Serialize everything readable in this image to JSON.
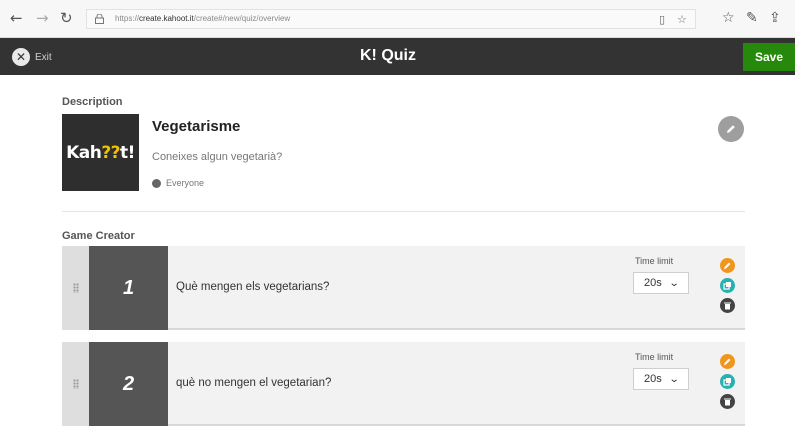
{
  "browser": {
    "url_prefix": "https://",
    "url_domain": "create.kahoot.it",
    "url_path": "/create#/new/quiz/overview"
  },
  "header": {
    "exit_label": "Exit",
    "title": "K! Quiz",
    "save_label": "Save"
  },
  "description": {
    "section_label": "Description",
    "cover_logo_left": "Kah",
    "cover_logo_qq": "??",
    "cover_logo_right": "t!",
    "title": "Vegetarisme",
    "text": "Coneixes algun vegetarià?",
    "visibility": "Everyone"
  },
  "game_creator": {
    "section_label": "Game Creator",
    "questions": [
      {
        "number": "1",
        "text": "Què mengen els vegetarians?",
        "time_limit_label": "Time limit",
        "time_limit": "20s"
      },
      {
        "number": "2",
        "text": "què no mengen el vegetarian?",
        "time_limit_label": "Time limit",
        "time_limit": "20s"
      }
    ]
  },
  "colors": {
    "header_bg": "#333333",
    "save_green": "#26890c",
    "edit_orange": "#f0951f",
    "duplicate_teal": "#2ab0b0",
    "delete_dark": "#444444"
  }
}
